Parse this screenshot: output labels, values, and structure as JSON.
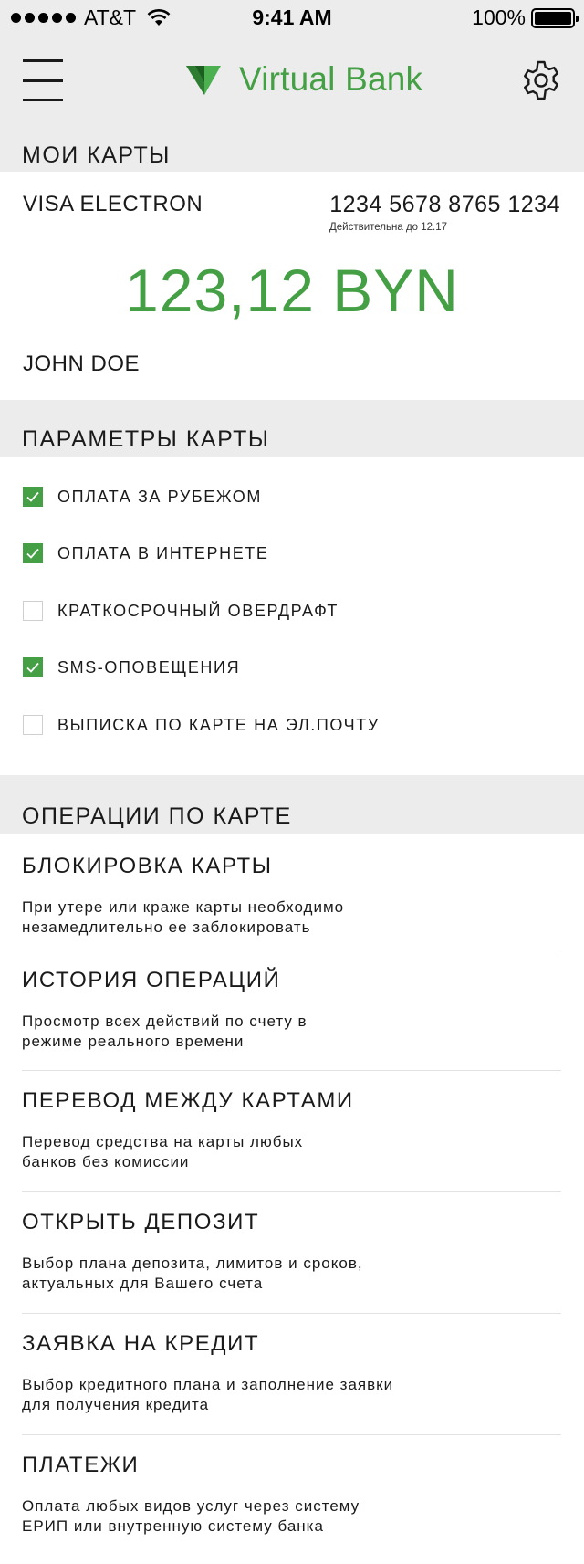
{
  "status_bar": {
    "carrier": "AT&T",
    "time": "9:41 AM",
    "battery": "100%"
  },
  "header": {
    "logo_text": "Virtual Bank",
    "brand_color": "#45a045"
  },
  "sections": {
    "my_cards": "МОИ КАРТЫ",
    "card_params": "ПАРАМЕТРЫ КАРТЫ",
    "card_operations": "ОПЕРАЦИИ ПО КАРТЕ"
  },
  "card": {
    "type": "VISA ELECTRON",
    "number": "1234 5678 8765 1234",
    "valid": "Действительна до 12.17",
    "balance": "123,12 BYN",
    "holder": "JOHN DOE"
  },
  "params": [
    {
      "label": "ОПЛАТА ЗА РУБЕЖОМ",
      "checked": true
    },
    {
      "label": "ОПЛАТА В ИНТЕРНЕТЕ",
      "checked": true
    },
    {
      "label": "КРАТКОСРОЧНЫЙ ОВЕРДРАФТ",
      "checked": false
    },
    {
      "label": "SMS-ОПОВЕЩЕНИЯ",
      "checked": true
    },
    {
      "label": "ВЫПИСКА ПО КАРТЕ НА ЭЛ.ПОЧТУ",
      "checked": false
    }
  ],
  "operations": [
    {
      "title": "БЛОКИРОВКА КАРТЫ",
      "description": "При утере или краже карты необходимо\nнезамедлительно ее заблокировать"
    },
    {
      "title": "ИСТОРИЯ ОПЕРАЦИЙ",
      "description": "Просмотр всех действий по счету в\nрежиме реального времени"
    },
    {
      "title": "ПЕРЕВОД МЕЖДУ КАРТАМИ",
      "description": "Перевод средства на карты любых\nбанков без комиссии"
    },
    {
      "title": "ОТКРЫТЬ ДЕПОЗИТ",
      "description": "Выбор плана депозита, лимитов и сроков,\nактуальных для Вашего счета"
    },
    {
      "title": "ЗАЯВКА НА КРЕДИТ",
      "description": "Выбор кредитного плана и заполнение заявки\nдля получения кредита"
    },
    {
      "title": "ПЛАТЕЖИ",
      "description": "Оплата любых видов услуг через систему\nЕРИП или внутренную систему банка"
    }
  ]
}
